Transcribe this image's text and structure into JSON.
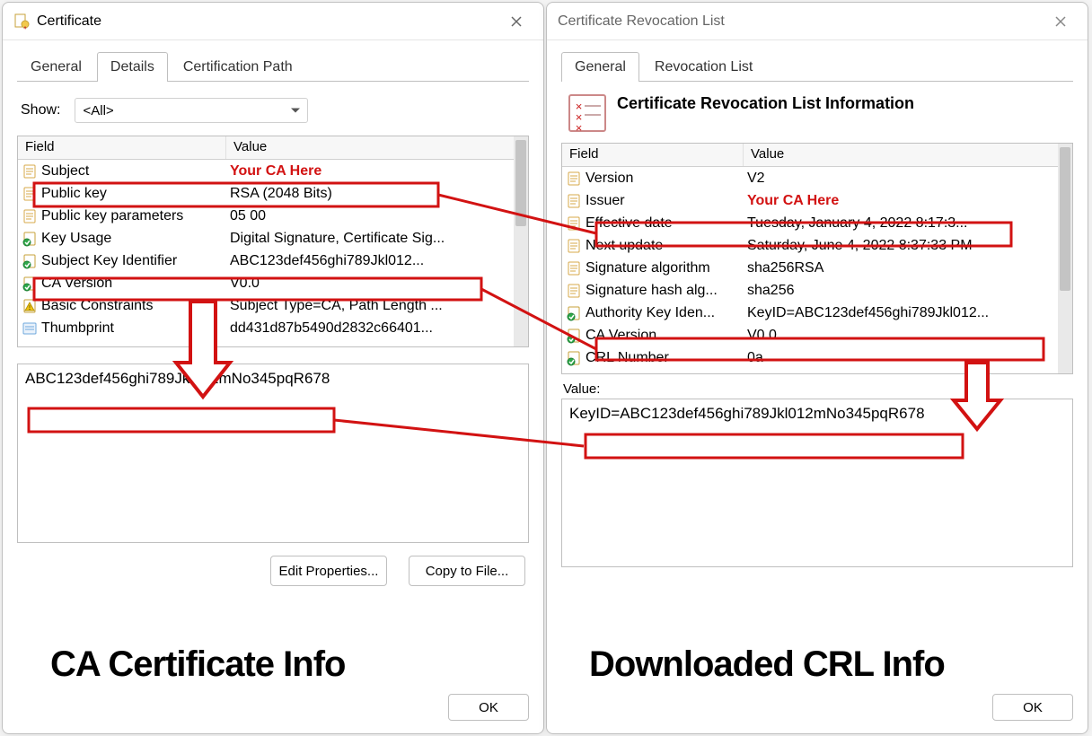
{
  "left": {
    "title": "Certificate",
    "tabs": [
      "General",
      "Details",
      "Certification Path"
    ],
    "active_tab": 1,
    "show_label": "Show:",
    "show_value": "<All>",
    "columns": [
      "Field",
      "Value"
    ],
    "rows": [
      {
        "icon": "doc",
        "field": "Subject",
        "value": "Your CA Here",
        "highlight": true
      },
      {
        "icon": "doc",
        "field": "Public key",
        "value": "RSA (2048 Bits)"
      },
      {
        "icon": "doc",
        "field": "Public key parameters",
        "value": "05 00"
      },
      {
        "icon": "ext",
        "field": "Key Usage",
        "value": "Digital Signature, Certificate Sig..."
      },
      {
        "icon": "ext",
        "field": "Subject Key Identifier",
        "value": "ABC123def456ghi789Jkl012..."
      },
      {
        "icon": "ext",
        "field": "CA Version",
        "value": "V0.0"
      },
      {
        "icon": "warn",
        "field": "Basic Constraints",
        "value": "Subject Type=CA, Path Length ..."
      },
      {
        "icon": "thumb",
        "field": "Thumbprint",
        "value": "dd431d87b5490d2832c66401..."
      }
    ],
    "value_text": "ABC123def456ghi789Jkl012mNo345pqR678",
    "buttons": {
      "edit": "Edit Properties...",
      "copy": "Copy to File..."
    },
    "ok": "OK",
    "caption": "CA Certificate Info"
  },
  "right": {
    "title": "Certificate Revocation List",
    "tabs": [
      "General",
      "Revocation List"
    ],
    "active_tab": 0,
    "info_heading": "Certificate Revocation List Information",
    "columns": [
      "Field",
      "Value"
    ],
    "rows": [
      {
        "icon": "doc",
        "field": "Version",
        "value": "V2"
      },
      {
        "icon": "doc",
        "field": "Issuer",
        "value": "Your CA Here",
        "highlight": true
      },
      {
        "icon": "doc",
        "field": "Effective date",
        "value": "Tuesday, January 4, 2022 8:17:3..."
      },
      {
        "icon": "doc",
        "field": "Next update",
        "value": "Saturday, June 4, 2022 8:37:33 PM"
      },
      {
        "icon": "doc",
        "field": "Signature algorithm",
        "value": "sha256RSA"
      },
      {
        "icon": "doc",
        "field": "Signature hash alg...",
        "value": "sha256"
      },
      {
        "icon": "ext",
        "field": "Authority Key Iden...",
        "value": "KeyID=ABC123def456ghi789Jkl012..."
      },
      {
        "icon": "ext",
        "field": "CA Version",
        "value": "V0.0"
      },
      {
        "icon": "ext",
        "field": "CRL Number",
        "value": "0a"
      }
    ],
    "value_label": "Value:",
    "value_text": "KeyID=ABC123def456ghi789Jkl012mNo345pqR678",
    "ok": "OK",
    "caption": "Downloaded CRL Info"
  },
  "annotations": {
    "color": "#d21212"
  }
}
